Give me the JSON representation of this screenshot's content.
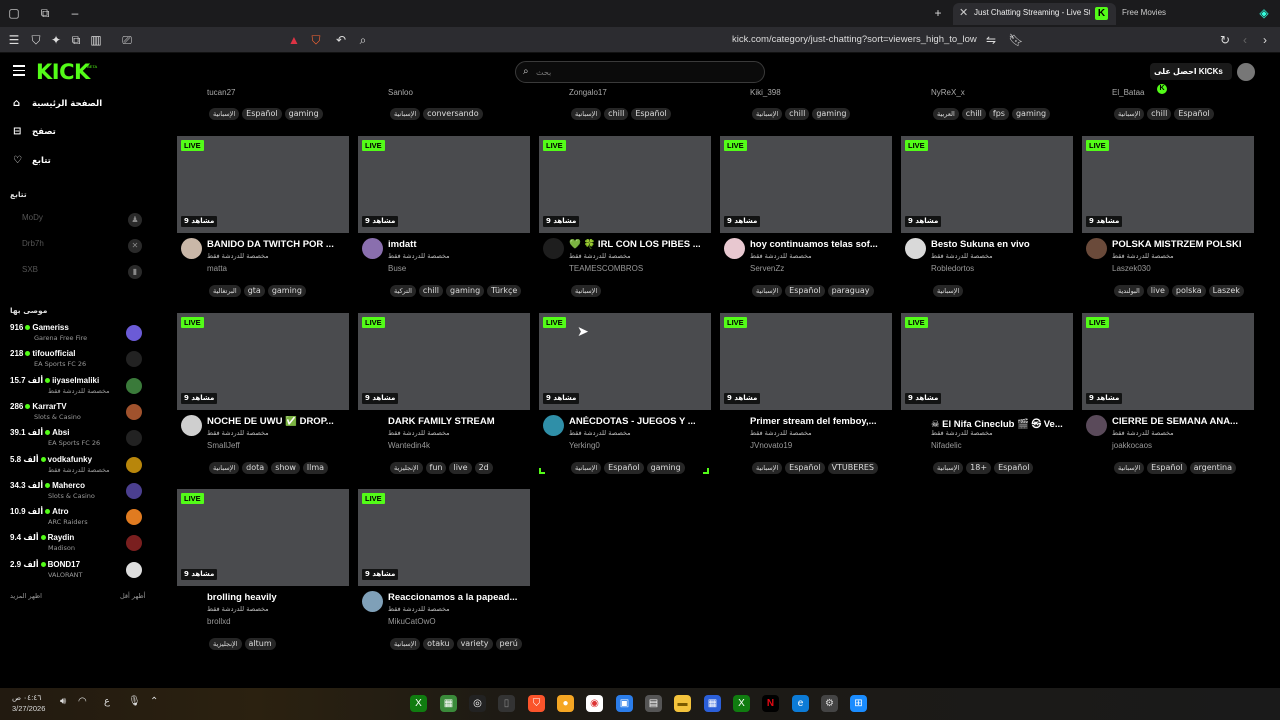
{
  "browser": {
    "active_tab_title": "Just Chatting Streaming - Live St",
    "second_tab_title": "Free Movies",
    "url": "kick.com/category/just-chatting?sort=viewers_high_to_low"
  },
  "header": {
    "logo_text": "KICK",
    "logo_badge": "BETA",
    "search_placeholder": "بحث",
    "kicks_label": "احصل على KICKs"
  },
  "sidebar": {
    "nav": [
      {
        "label": "الصفحة الرئيسية",
        "icon": "home-icon"
      },
      {
        "label": "تصفح",
        "icon": "browse-icon"
      },
      {
        "label": "تتابع",
        "icon": "heart-icon"
      }
    ],
    "following_heading": "تتابع",
    "following": [
      "MoDy",
      "Drb7h",
      "SXB"
    ],
    "recommended_heading": "موصى بها",
    "recommended": [
      {
        "count": "916",
        "name": "Gameriss",
        "category": "Garena Free Fire",
        "color": "#6b5bd6"
      },
      {
        "count": "218",
        "name": "tifouofficial",
        "category": "EA Sports FC 26",
        "color": "#222"
      },
      {
        "count": "15.7 ألف",
        "name": "iiyaselmaliki",
        "category": "مخصصة للدردشة فقط",
        "color": "#3a7a3a"
      },
      {
        "count": "286",
        "name": "KarrarTV",
        "category": "Slots & Casino",
        "color": "#a0522d"
      },
      {
        "count": "39.1 ألف",
        "name": "Absi",
        "category": "EA Sports FC 26",
        "color": "#222"
      },
      {
        "count": "5.8 ألف",
        "name": "vodkafunky",
        "category": "مخصصة للدردشة فقط",
        "color": "#b8860b"
      },
      {
        "count": "34.3 ألف",
        "name": "Maherco",
        "category": "Slots & Casino",
        "color": "#4b3f8f"
      },
      {
        "count": "10.9 ألف",
        "name": "Atro",
        "category": "ARC Raiders",
        "color": "#e07b20"
      },
      {
        "count": "9.4 ألف",
        "name": "Raydin",
        "category": "Madison",
        "color": "#7a1f1f"
      },
      {
        "count": "2.9 ألف",
        "name": "BOND17",
        "category": "VALORANT",
        "color": "#ddd"
      }
    ],
    "show_more": "اظهر المزيد",
    "show_less": "أظهر أقل"
  },
  "grid": {
    "live_label": "LIVE",
    "category_label": "مخصصة للدردشة فقط",
    "top_row": [
      {
        "user": "tucan27",
        "tags": [
          "الإسبانية",
          "Español",
          "gaming"
        ]
      },
      {
        "user": "Sanloo",
        "tags": [
          "الإسبانية",
          "conversando"
        ]
      },
      {
        "user": "Zongalo17",
        "tags": [
          "الإسبانية",
          "chill",
          "Español"
        ]
      },
      {
        "user": "Kiki_398",
        "tags": [
          "الإسبانية",
          "chill",
          "gaming"
        ]
      },
      {
        "user": "NyReX_x",
        "tags": [
          "العربية",
          "chill",
          "fps",
          "gaming"
        ]
      },
      {
        "user": "El_Bataa",
        "tags": [
          "الإسبانية",
          "chill",
          "Español"
        ]
      }
    ],
    "cards": [
      {
        "viewers": "9 مشاهد",
        "title": "BANIDO DA TWITCH POR ...",
        "user": "matta",
        "tags": [
          "البرتغالية",
          "gta",
          "gaming"
        ],
        "avatar_color": "#c9b7a8"
      },
      {
        "viewers": "9 مشاهد",
        "title": "imdatt",
        "user": "Buse",
        "tags": [
          "التركية",
          "chill",
          "gaming",
          "Türkçe"
        ],
        "avatar_color": "#8a6fae"
      },
      {
        "viewers": "9 مشاهد",
        "title": "💚 🍀 IRL CON LOS PIBES ...",
        "user": "TEAMESCOMBROS",
        "tags": [
          "الإسبانية"
        ],
        "avatar_color": "#1e1e1e"
      },
      {
        "viewers": "9 مشاهد",
        "title": "hoy continuamos telas sof...",
        "user": "ServenZz",
        "tags": [
          "الإسبانية",
          "Español",
          "paraguay"
        ],
        "avatar_color": "#e8c8d0"
      },
      {
        "viewers": "9 مشاهد",
        "title": "Besto Sukuna en vivo",
        "user": "Robledortos",
        "tags": [
          "الإسبانية"
        ],
        "avatar_color": "#d9d9d9"
      },
      {
        "viewers": "9 مشاهد",
        "title": "POLSKA MISTRZEM POLSKI",
        "user": "Laszek030",
        "tags": [
          "البولندية",
          "live",
          "polska",
          "Laszek"
        ],
        "avatar_color": "#6a4a3a"
      },
      {
        "viewers": "9 مشاهد",
        "title": "NOCHE DE UWU ✅ DROP...",
        "user": "SmallJeff",
        "tags": [
          "الإسبانية",
          "dota",
          "show",
          "llma"
        ],
        "avatar_color": "#cfcfcf"
      },
      {
        "viewers": "9 مشاهد",
        "title": "DARK FAMILY STREAM",
        "user": "Wantedin4k",
        "tags": [
          "الإنجليزية",
          "fun",
          "live",
          "2d"
        ],
        "avatar_color": "#000"
      },
      {
        "viewers": "9 مشاهد",
        "title": "ANÉCDOTAS - JUEGOS Y ...",
        "user": "Yerking0",
        "tags": [
          "الإسبانية",
          "Español",
          "gaming"
        ],
        "avatar_color": "#2f8fa8"
      },
      {
        "viewers": "9 مشاهد",
        "title": "Primer stream del femboy,...",
        "user": "JVnovato19",
        "tags": [
          "الإسبانية",
          "Español",
          "VTUBERES"
        ],
        "avatar_color": "#000"
      },
      {
        "viewers": "9 مشاهد",
        "title": "☠ El Nifa Cineclub 🎬 ㉿ Ve...",
        "user": "Nifadelic",
        "tags": [
          "الإسبانية",
          "18+",
          "Español"
        ],
        "avatar_color": "#000"
      },
      {
        "viewers": "9 مشاهد",
        "title": "CIERRE DE SEMANA ANA...",
        "user": "joakkocaos",
        "tags": [
          "الإسبانية",
          "Español",
          "argentina"
        ],
        "avatar_color": "#5a4a5a"
      },
      {
        "viewers": "9 مشاهد",
        "title": "brolling heavily",
        "user": "brollxd",
        "tags": [
          "الإنجليزية",
          "altum"
        ],
        "avatar_color": "#000"
      },
      {
        "viewers": "9 مشاهد",
        "title": "Reaccionamos a la papead...",
        "user": "MikuCatOwO",
        "tags": [
          "الإسبانية",
          "otaku",
          "variety",
          "perú"
        ],
        "avatar_color": "#7fa0b8"
      }
    ]
  },
  "taskbar": {
    "time": "٠٤:٤٦ ص",
    "date": "3/27/2026",
    "lang": "ع"
  }
}
